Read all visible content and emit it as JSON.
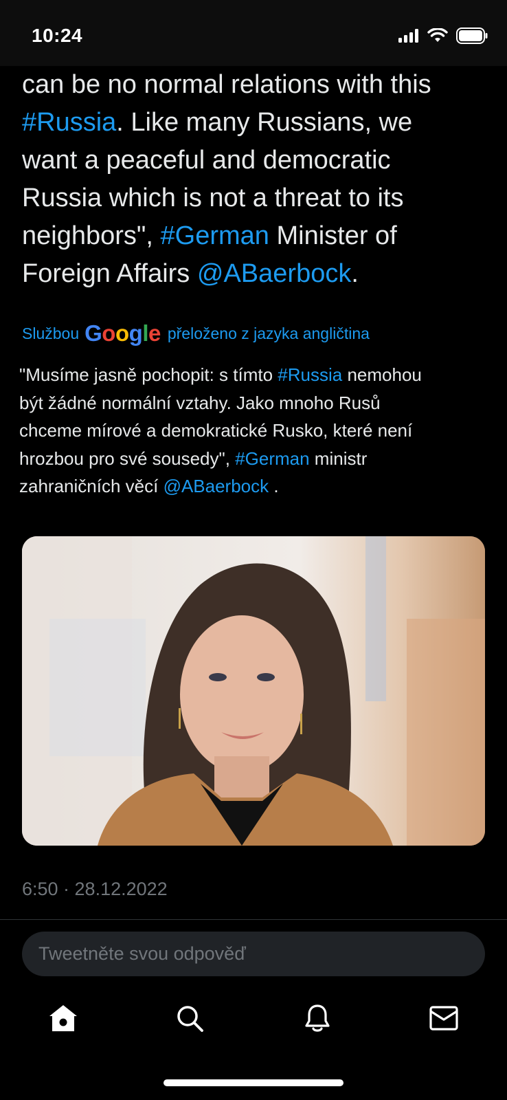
{
  "status_bar": {
    "time": "10:24"
  },
  "tweet": {
    "lines": [
      {
        "text": "can be no normal relations with this"
      },
      {
        "link": "#Russia",
        "text": ". Like many Russians, we"
      },
      {
        "text": "want a peaceful and democratic"
      },
      {
        "text": "Russia which is not a threat to its"
      },
      {
        "pre": "neighbors\", ",
        "link": "#German",
        "text": " Minister of"
      },
      {
        "pre": "Foreign Affairs ",
        "link": "@ABaerbock",
        "text": "."
      }
    ]
  },
  "translation": {
    "prefix": "Službou",
    "google_letters": [
      "G",
      "o",
      "o",
      "g",
      "l",
      "e"
    ],
    "suffix": "přeloženo z jazyka angličtina",
    "lines": [
      {
        "pre": "\"Musíme jasně pochopit: s tímto ",
        "link": "#Russia",
        "text": " nemohou"
      },
      {
        "text": "být žádné normální vztahy. Jako mnoho Rusů"
      },
      {
        "text": "chceme mírové a demokratické Rusko, které není"
      },
      {
        "pre": "hrozbou pro své sousedy\", ",
        "link": "#German",
        "text": " ministr"
      },
      {
        "pre": "zahraničních věcí ",
        "link": "@ABaerbock",
        "text": " ."
      }
    ]
  },
  "timestamp": "6:50 · 28.12.2022",
  "reply": {
    "placeholder": "Tweetněte svou odpověď"
  },
  "tab_bar": {
    "items": [
      {
        "icon": "home-icon"
      },
      {
        "icon": "search-icon"
      },
      {
        "icon": "bell-icon"
      },
      {
        "icon": "mail-icon"
      }
    ]
  },
  "colors": {
    "background": "#000000",
    "text": "#E7E9EA",
    "link": "#1D9BF0",
    "muted": "#71767B",
    "reply_box": "#202327"
  }
}
